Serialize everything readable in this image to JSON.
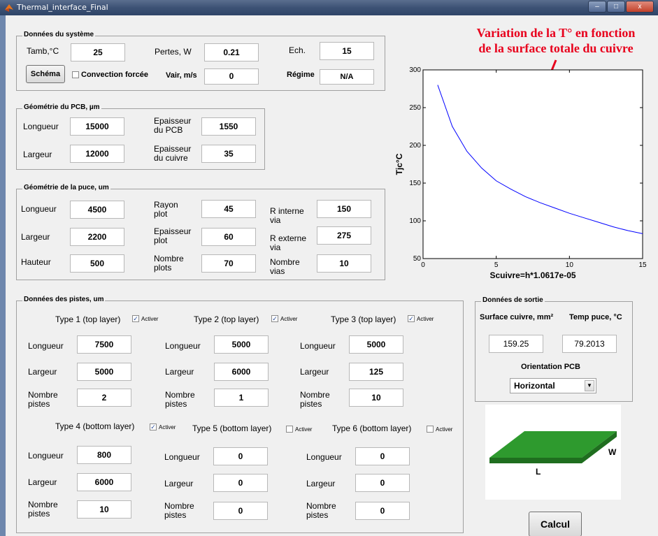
{
  "window": {
    "title": "Thermal_interface_Final",
    "buttons": {
      "minimize": "–",
      "maximize": "□",
      "close": "x"
    }
  },
  "annotation": {
    "line1": "Variation de la T° en fonction",
    "line2": "de la surface totale du cuivre"
  },
  "system": {
    "legend": "Données du système",
    "tamb_label": "Tamb,°C",
    "tamb": "25",
    "pertes_label": "Pertes, W",
    "pertes": "0.21",
    "ech_label": "Ech.",
    "ech": "15",
    "schema_label": "Schéma",
    "convection_label": "Convection forcée",
    "vair_label": "Vair, m/s",
    "vair": "0",
    "regime_label": "Régime",
    "regime": "N/A"
  },
  "pcb": {
    "legend": "Géométrie du PCB, µm",
    "longueur_label": "Longueur",
    "longueur": "15000",
    "largeur_label": "Largeur",
    "largeur": "12000",
    "ep_pcb_label_1": "Epaisseur",
    "ep_pcb_label_2": "du PCB",
    "ep_pcb": "1550",
    "ep_cu_label_1": "Epaisseur",
    "ep_cu_label_2": "du cuivre",
    "ep_cu": "35"
  },
  "puce": {
    "legend": "Géométrie de la puce, um",
    "longueur_label": "Longueur",
    "longueur": "4500",
    "largeur_label": "Largeur",
    "largeur": "2200",
    "hauteur_label": "Hauteur",
    "hauteur": "500",
    "rayon_label_1": "Rayon",
    "rayon_label_2": "plot",
    "rayon": "45",
    "ep_plot_label_1": "Epaisseur",
    "ep_plot_label_2": "plot",
    "ep_plot": "60",
    "nb_plots_label_1": "Nombre",
    "nb_plots_label_2": "plots",
    "nb_plots": "70",
    "rint_label_1": "R interne",
    "rint_label_2": "via",
    "rint": "150",
    "rext_label_1": "R externe",
    "rext_label_2": "via",
    "rext": "275",
    "nvias_label_1": "Nombre",
    "nvias_label_2": "vias",
    "nvias": "10"
  },
  "pistes": {
    "legend": "Données des pistes, um",
    "activer": "Activer",
    "longueur_label": "Longueur",
    "largeur_label": "Largeur",
    "nombre_label_1": "Nombre",
    "nombre_label_2": "pistes",
    "types": [
      {
        "title": "Type 1 (top layer)",
        "checked": true,
        "longueur": "7500",
        "largeur": "5000",
        "nombre": "2"
      },
      {
        "title": "Type 2 (top layer)",
        "checked": true,
        "longueur": "5000",
        "largeur": "6000",
        "nombre": "1"
      },
      {
        "title": "Type 3 (top layer)",
        "checked": true,
        "longueur": "5000",
        "largeur": "125",
        "nombre": "10"
      },
      {
        "title": "Type 4 (bottom layer)",
        "checked": true,
        "longueur": "800",
        "largeur": "6000",
        "nombre": "10"
      },
      {
        "title": "Type 5 (bottom layer)",
        "checked": false,
        "longueur": "0",
        "largeur": "0",
        "nombre": "0"
      },
      {
        "title": "Type 6 (bottom layer)",
        "checked": false,
        "longueur": "0",
        "largeur": "0",
        "nombre": "0"
      }
    ]
  },
  "sortie": {
    "legend": "Données de sortie",
    "surface_label": "Surface cuivre, mm²",
    "surface": "159.25",
    "temp_label": "Temp puce, °C",
    "temp": "79.2013",
    "orientation_label": "Orientation PCB",
    "orientation": "Horizontal"
  },
  "board": {
    "w_label": "W",
    "l_label": "L",
    "top_color": "#2e9a2e",
    "side_color": "#1f6e1f"
  },
  "calcul_label": "Calcul",
  "chart_data": {
    "type": "line",
    "ylabel": "Tjc°C",
    "xlabel": "Scuivre=h*1.0617e-05",
    "xlim": [
      0,
      15
    ],
    "ylim": [
      50,
      300
    ],
    "xticks": [
      "0",
      "5",
      "10",
      "15"
    ],
    "yticks": [
      "50",
      "100",
      "150",
      "200",
      "250",
      "300"
    ],
    "series": [
      {
        "color": "#0000ff",
        "x": [
          1,
          2,
          3,
          4,
          5,
          6,
          7,
          8,
          9,
          10,
          11,
          12,
          13,
          14,
          15
        ],
        "y": [
          280,
          225,
          192,
          170,
          153,
          142,
          132,
          124,
          117,
          110,
          104,
          98,
          92,
          87,
          83
        ]
      }
    ]
  }
}
